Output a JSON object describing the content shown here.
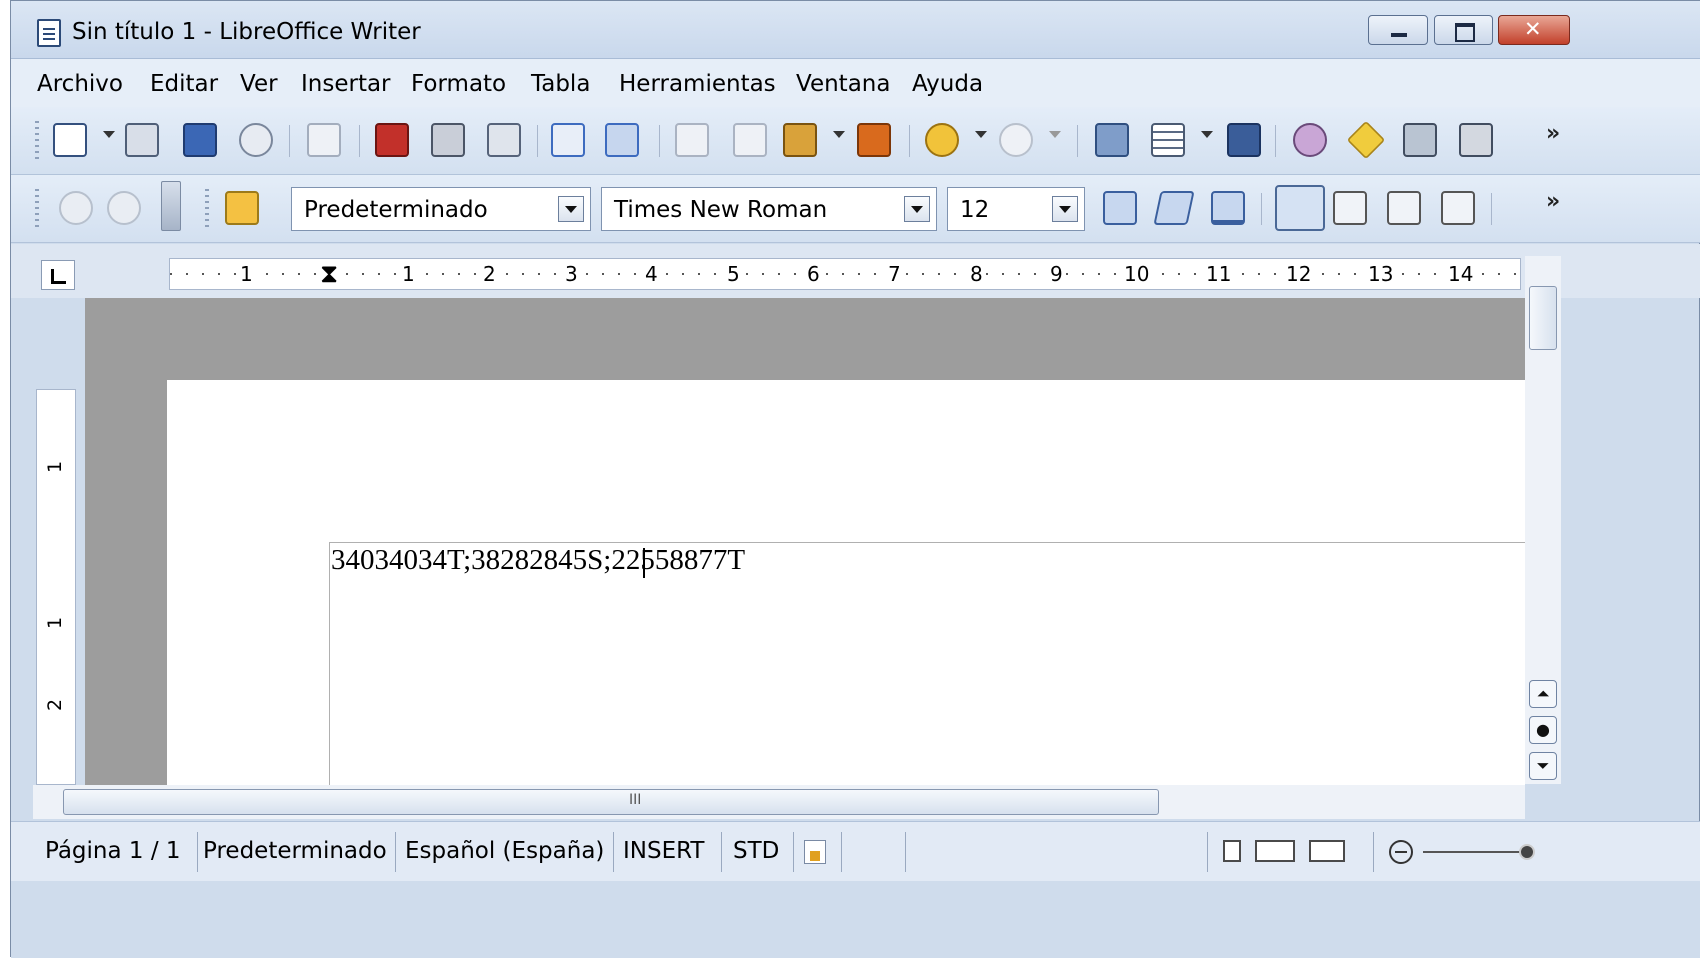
{
  "window": {
    "title": "Sin título 1 - LibreOffice Writer"
  },
  "menu": [
    "Archivo",
    "Editar",
    "Ver",
    "Insertar",
    "Formato",
    "Tabla",
    "Herramientas",
    "Ventana",
    "Ayuda"
  ],
  "toolbar_standard": {
    "icons": [
      "new-document-icon",
      "open-icon",
      "save-icon",
      "email-icon",
      "edit-file-icon",
      "export-pdf-icon",
      "print-icon",
      "page-preview-icon",
      "spellcheck-icon",
      "autospellcheck-icon",
      "cut-icon",
      "copy-icon",
      "paste-icon",
      "clone-formatting-icon",
      "undo-icon",
      "redo-icon",
      "navigator-icon",
      "table-icon",
      "draw-functions-icon",
      "find-replace-icon",
      "gallery-icon",
      "data-sources-icon",
      "nonprinting-chars-icon"
    ]
  },
  "toolbar_formatting": {
    "paragraph_style": "Predeterminado",
    "font_name": "Times New Roman",
    "font_size": "12",
    "icons": [
      "back-icon",
      "forward-icon",
      "styles-icon",
      "bold-icon",
      "italic-icon",
      "underline-icon",
      "align-left-icon",
      "align-center-icon",
      "align-right-icon",
      "justify-icon"
    ]
  },
  "ruler": {
    "labels": [
      "1",
      "1",
      "2",
      "3",
      "4",
      "5",
      "6",
      "7",
      "8",
      "9",
      "10",
      "11",
      "12",
      "13",
      "14"
    ],
    "vertical_labels": [
      "1",
      "1",
      "2"
    ]
  },
  "document": {
    "text": "34034034T;38282845S;22558877T"
  },
  "scrollbar": {
    "hgrip": "III"
  },
  "status": {
    "page": "Página  1 / 1",
    "style": "Predeterminado",
    "language": "Español (España)",
    "mode": "INSERT",
    "selection": "STD"
  }
}
